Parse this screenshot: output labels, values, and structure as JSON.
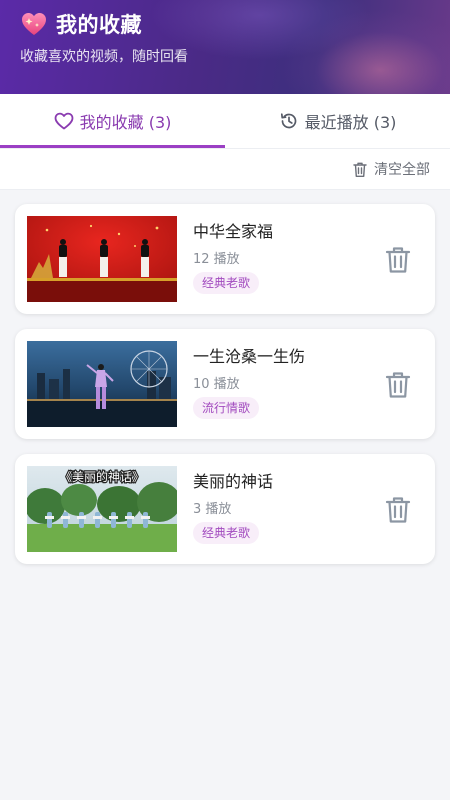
{
  "header": {
    "title": "我的收藏",
    "subtitle": "收藏喜欢的视频，随时回看"
  },
  "tabs": [
    {
      "label": "我的收藏 (3)",
      "icon": "heart-icon",
      "active": true
    },
    {
      "label": "最近播放 (3)",
      "icon": "history-icon",
      "active": false
    }
  ],
  "toolbar": {
    "clear_label": "清空全部",
    "icon": "trash-icon"
  },
  "colors": {
    "accent": "#9b3fc4",
    "tag_bg": "#f8eef9",
    "tag_text": "#a24bbf"
  },
  "favorites": [
    {
      "title": "中华全家福",
      "plays": "12 播放",
      "tag": "经典老歌"
    },
    {
      "title": "一生沧桑一生伤",
      "plays": "10 播放",
      "tag": "流行情歌"
    },
    {
      "title": "美丽的神话",
      "plays": "3 播放",
      "tag": "经典老歌",
      "thumb_text": "《美丽的神话》"
    }
  ]
}
